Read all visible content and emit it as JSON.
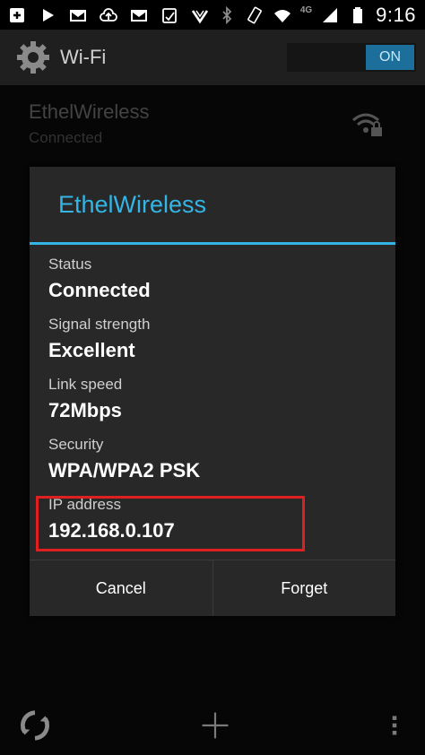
{
  "status_bar": {
    "icons": [
      "plus-box-icon",
      "play-icon",
      "gmail-icon",
      "cloud-upload-icon",
      "gmail-icon",
      "clipboard-icon",
      "checkmark-icon",
      "bluetooth-icon",
      "rotate-icon",
      "wifi-icon",
      "signal-icon",
      "battery-icon"
    ],
    "network_type": "4G",
    "time": "9:16"
  },
  "action_bar": {
    "title": "Wi-Fi",
    "toggle_label": "ON"
  },
  "networks": [
    {
      "name": "EthelWireless",
      "status": "Connected"
    }
  ],
  "dialog": {
    "title": "EthelWireless",
    "fields": [
      {
        "label": "Status",
        "value": "Connected"
      },
      {
        "label": "Signal strength",
        "value": "Excellent"
      },
      {
        "label": "Link speed",
        "value": "72Mbps"
      },
      {
        "label": "Security",
        "value": "WPA/WPA2 PSK"
      },
      {
        "label": "IP address",
        "value": "192.168.0.107"
      }
    ],
    "buttons": {
      "cancel": "Cancel",
      "forget": "Forget"
    },
    "highlight_color": "#e02020",
    "accent_color": "#33b5e5"
  },
  "bottom_bar": {
    "icons": [
      "wps-icon",
      "add-network-icon",
      "overflow-menu-icon"
    ]
  }
}
